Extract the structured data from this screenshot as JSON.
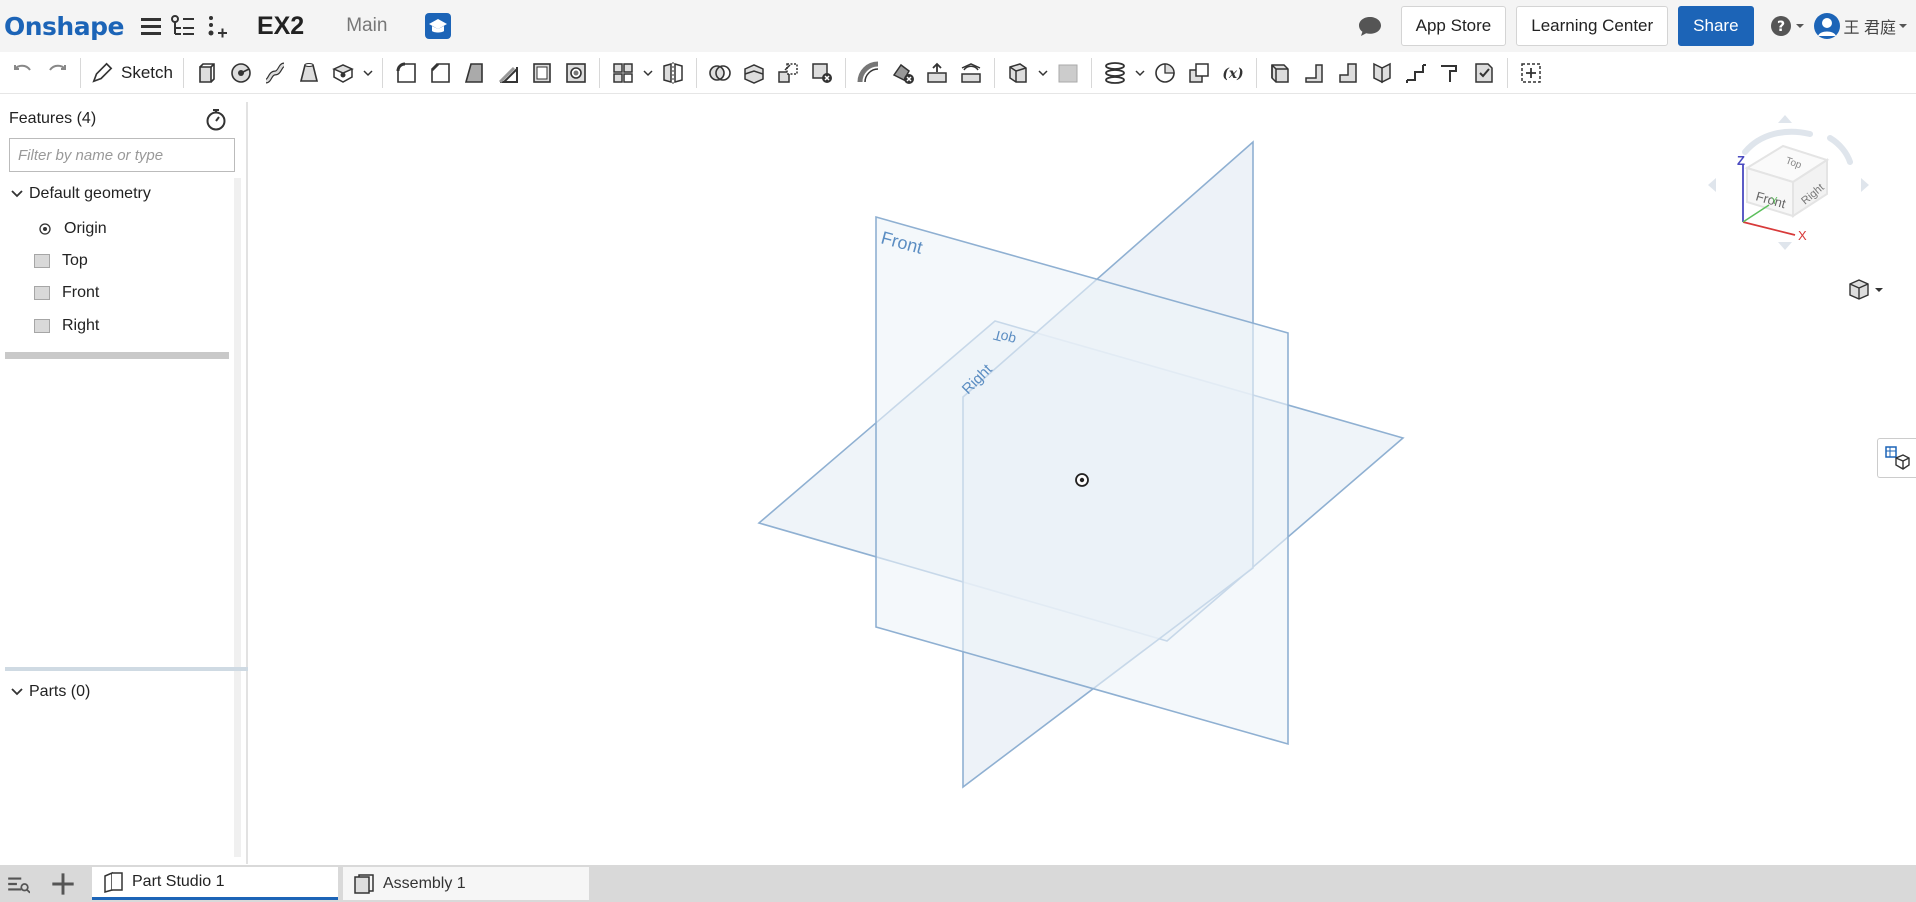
{
  "header": {
    "logo": "Onshape",
    "document_name": "EX2",
    "workspace": "Main",
    "app_store": "App Store",
    "learning_center": "Learning Center",
    "share": "Share",
    "user_name": "王 君庭",
    "brand_color": "#1c64b7"
  },
  "toolbar": {
    "sketch_label": "Sketch",
    "icons": [
      "undo-icon",
      "redo-icon",
      "sketch-icon",
      "extrude-icon",
      "revolve-icon",
      "sweep-icon",
      "loft-icon",
      "thicken-icon",
      "fillet-icon",
      "chamfer-icon",
      "draft-icon",
      "rib-icon",
      "shell-icon",
      "hole-icon",
      "pattern-icon",
      "mirror-icon",
      "boolean-icon",
      "split-icon",
      "transform-icon",
      "delete-part-icon",
      "modify-fillet-icon",
      "delete-face-icon",
      "move-face-icon",
      "replace-face-icon",
      "plane-icon",
      "mate-connector-icon",
      "helix-icon",
      "wrap-icon",
      "variable-icon",
      "sheet-metal-icon",
      "flange-icon",
      "tab-icon",
      "bend-icon",
      "joint-icon",
      "corner-icon",
      "finish-icon",
      "add-custom-feature-icon"
    ]
  },
  "feature_panel": {
    "title": "Features (4)",
    "filter_placeholder": "Filter by name or type",
    "default_geometry": "Default geometry",
    "items": [
      {
        "label": "Origin",
        "icon": "origin-icon"
      },
      {
        "label": "Top",
        "icon": "plane-icon"
      },
      {
        "label": "Front",
        "icon": "plane-icon"
      },
      {
        "label": "Right",
        "icon": "plane-icon"
      }
    ],
    "parts_label": "Parts (0)"
  },
  "viewport": {
    "plane_labels": {
      "front": "Front",
      "top": "Top",
      "right": "Right"
    },
    "plane_color": "#7fa6cc",
    "viewcube": {
      "top": "Top",
      "front": "Front",
      "right": "Right",
      "axis_x": "X",
      "axis_y": "Y",
      "axis_z": "Z"
    }
  },
  "tabs": [
    {
      "label": "Part Studio 1",
      "active": true
    },
    {
      "label": "Assembly 1",
      "active": false
    }
  ]
}
